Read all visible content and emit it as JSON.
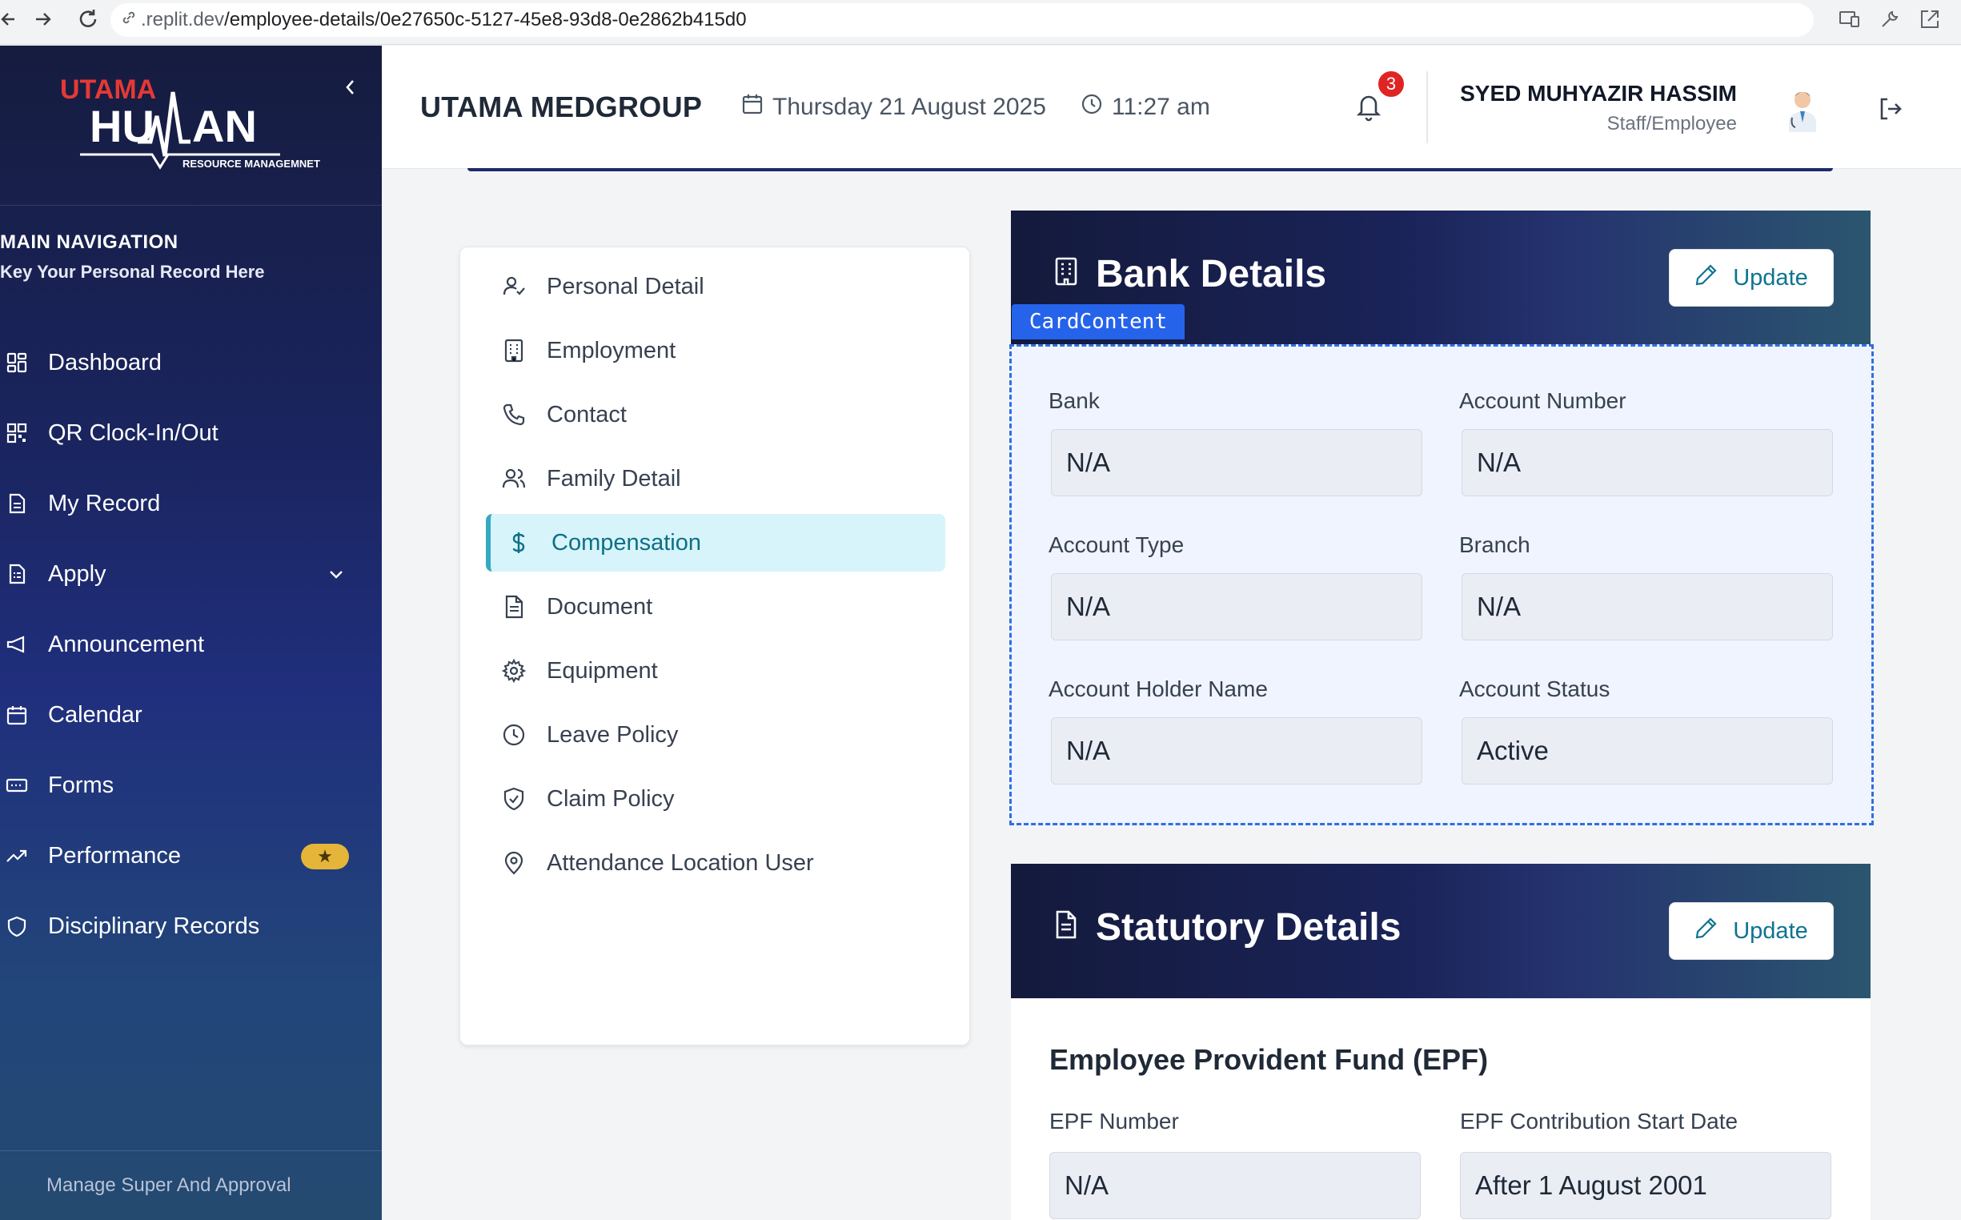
{
  "browser": {
    "url_host": ".replit.dev",
    "url_path": "/employee-details/0e27650c-5127-45e8-93d8-0e2862b415d0"
  },
  "logo": {
    "brand_top": "UTAMA",
    "brand_main_left": "HU",
    "brand_main_right": "AN",
    "brand_sub": "RESOURCE MANAGEMNET"
  },
  "sidebar": {
    "nav_title": "MAIN NAVIGATION",
    "nav_subtitle": "Key Your Personal Record Here",
    "items": [
      {
        "label": "Dashboard",
        "icon": "grid-icon"
      },
      {
        "label": "QR Clock-In/Out",
        "icon": "qr-code-icon"
      },
      {
        "label": "My Record",
        "icon": "document-icon"
      },
      {
        "label": "Apply",
        "icon": "form-icon"
      },
      {
        "label": "Announcement",
        "icon": "megaphone-icon"
      },
      {
        "label": "Calendar",
        "icon": "calendar-icon"
      },
      {
        "label": "Forms",
        "icon": "forms-icon"
      },
      {
        "label": "Performance",
        "icon": "trending-up-icon"
      },
      {
        "label": "Disciplinary Records",
        "icon": "shield-icon"
      }
    ],
    "performance_badge": "★",
    "footer": "Manage Super And Approval"
  },
  "header": {
    "company": "UTAMA MEDGROUP",
    "date": "Thursday 21 August 2025",
    "time": "11:27 am",
    "notification_count": "3",
    "user_name": "SYED MUHYAZIR HASSIM",
    "user_role": "Staff/Employee"
  },
  "menu": {
    "items": [
      {
        "label": "Personal Detail",
        "icon": "user-check-icon"
      },
      {
        "label": "Employment",
        "icon": "building-icon"
      },
      {
        "label": "Contact",
        "icon": "phone-icon"
      },
      {
        "label": "Family Detail",
        "icon": "users-icon"
      },
      {
        "label": "Compensation",
        "icon": "dollar-icon"
      },
      {
        "label": "Document",
        "icon": "document-icon"
      },
      {
        "label": "Equipment",
        "icon": "gear-icon"
      },
      {
        "label": "Leave Policy",
        "icon": "clock-icon"
      },
      {
        "label": "Claim Policy",
        "icon": "shield-check-icon"
      },
      {
        "label": "Attendance Location User",
        "icon": "map-pin-icon"
      }
    ],
    "active": "Compensation"
  },
  "bank_details": {
    "title": "Bank Details",
    "update_label": "Update",
    "card_content_tag": "CardContent",
    "fields": {
      "bank": {
        "label": "Bank",
        "value": "N/A"
      },
      "account_number": {
        "label": "Account Number",
        "value": "N/A"
      },
      "account_type": {
        "label": "Account Type",
        "value": "N/A"
      },
      "branch": {
        "label": "Branch",
        "value": "N/A"
      },
      "holder_name": {
        "label": "Account Holder Name",
        "value": "N/A"
      },
      "account_status": {
        "label": "Account Status",
        "value": "Active"
      }
    }
  },
  "statutory_details": {
    "title": "Statutory Details",
    "update_label": "Update",
    "epf_section": "Employee Provident Fund (EPF)",
    "fields": {
      "epf_number": {
        "label": "EPF Number",
        "value": "N/A"
      },
      "epf_start": {
        "label": "EPF Contribution Start Date",
        "value": "After 1 August 2001"
      }
    }
  },
  "colors": {
    "sidebar_top": "#161c3f",
    "sidebar_bottom": "#244a70",
    "accent_teal": "#0e7490",
    "active_bg": "#d6f4fa",
    "badge_red": "#e02424",
    "badge_gold": "#e5b53a",
    "logo_red": "#e53935"
  }
}
